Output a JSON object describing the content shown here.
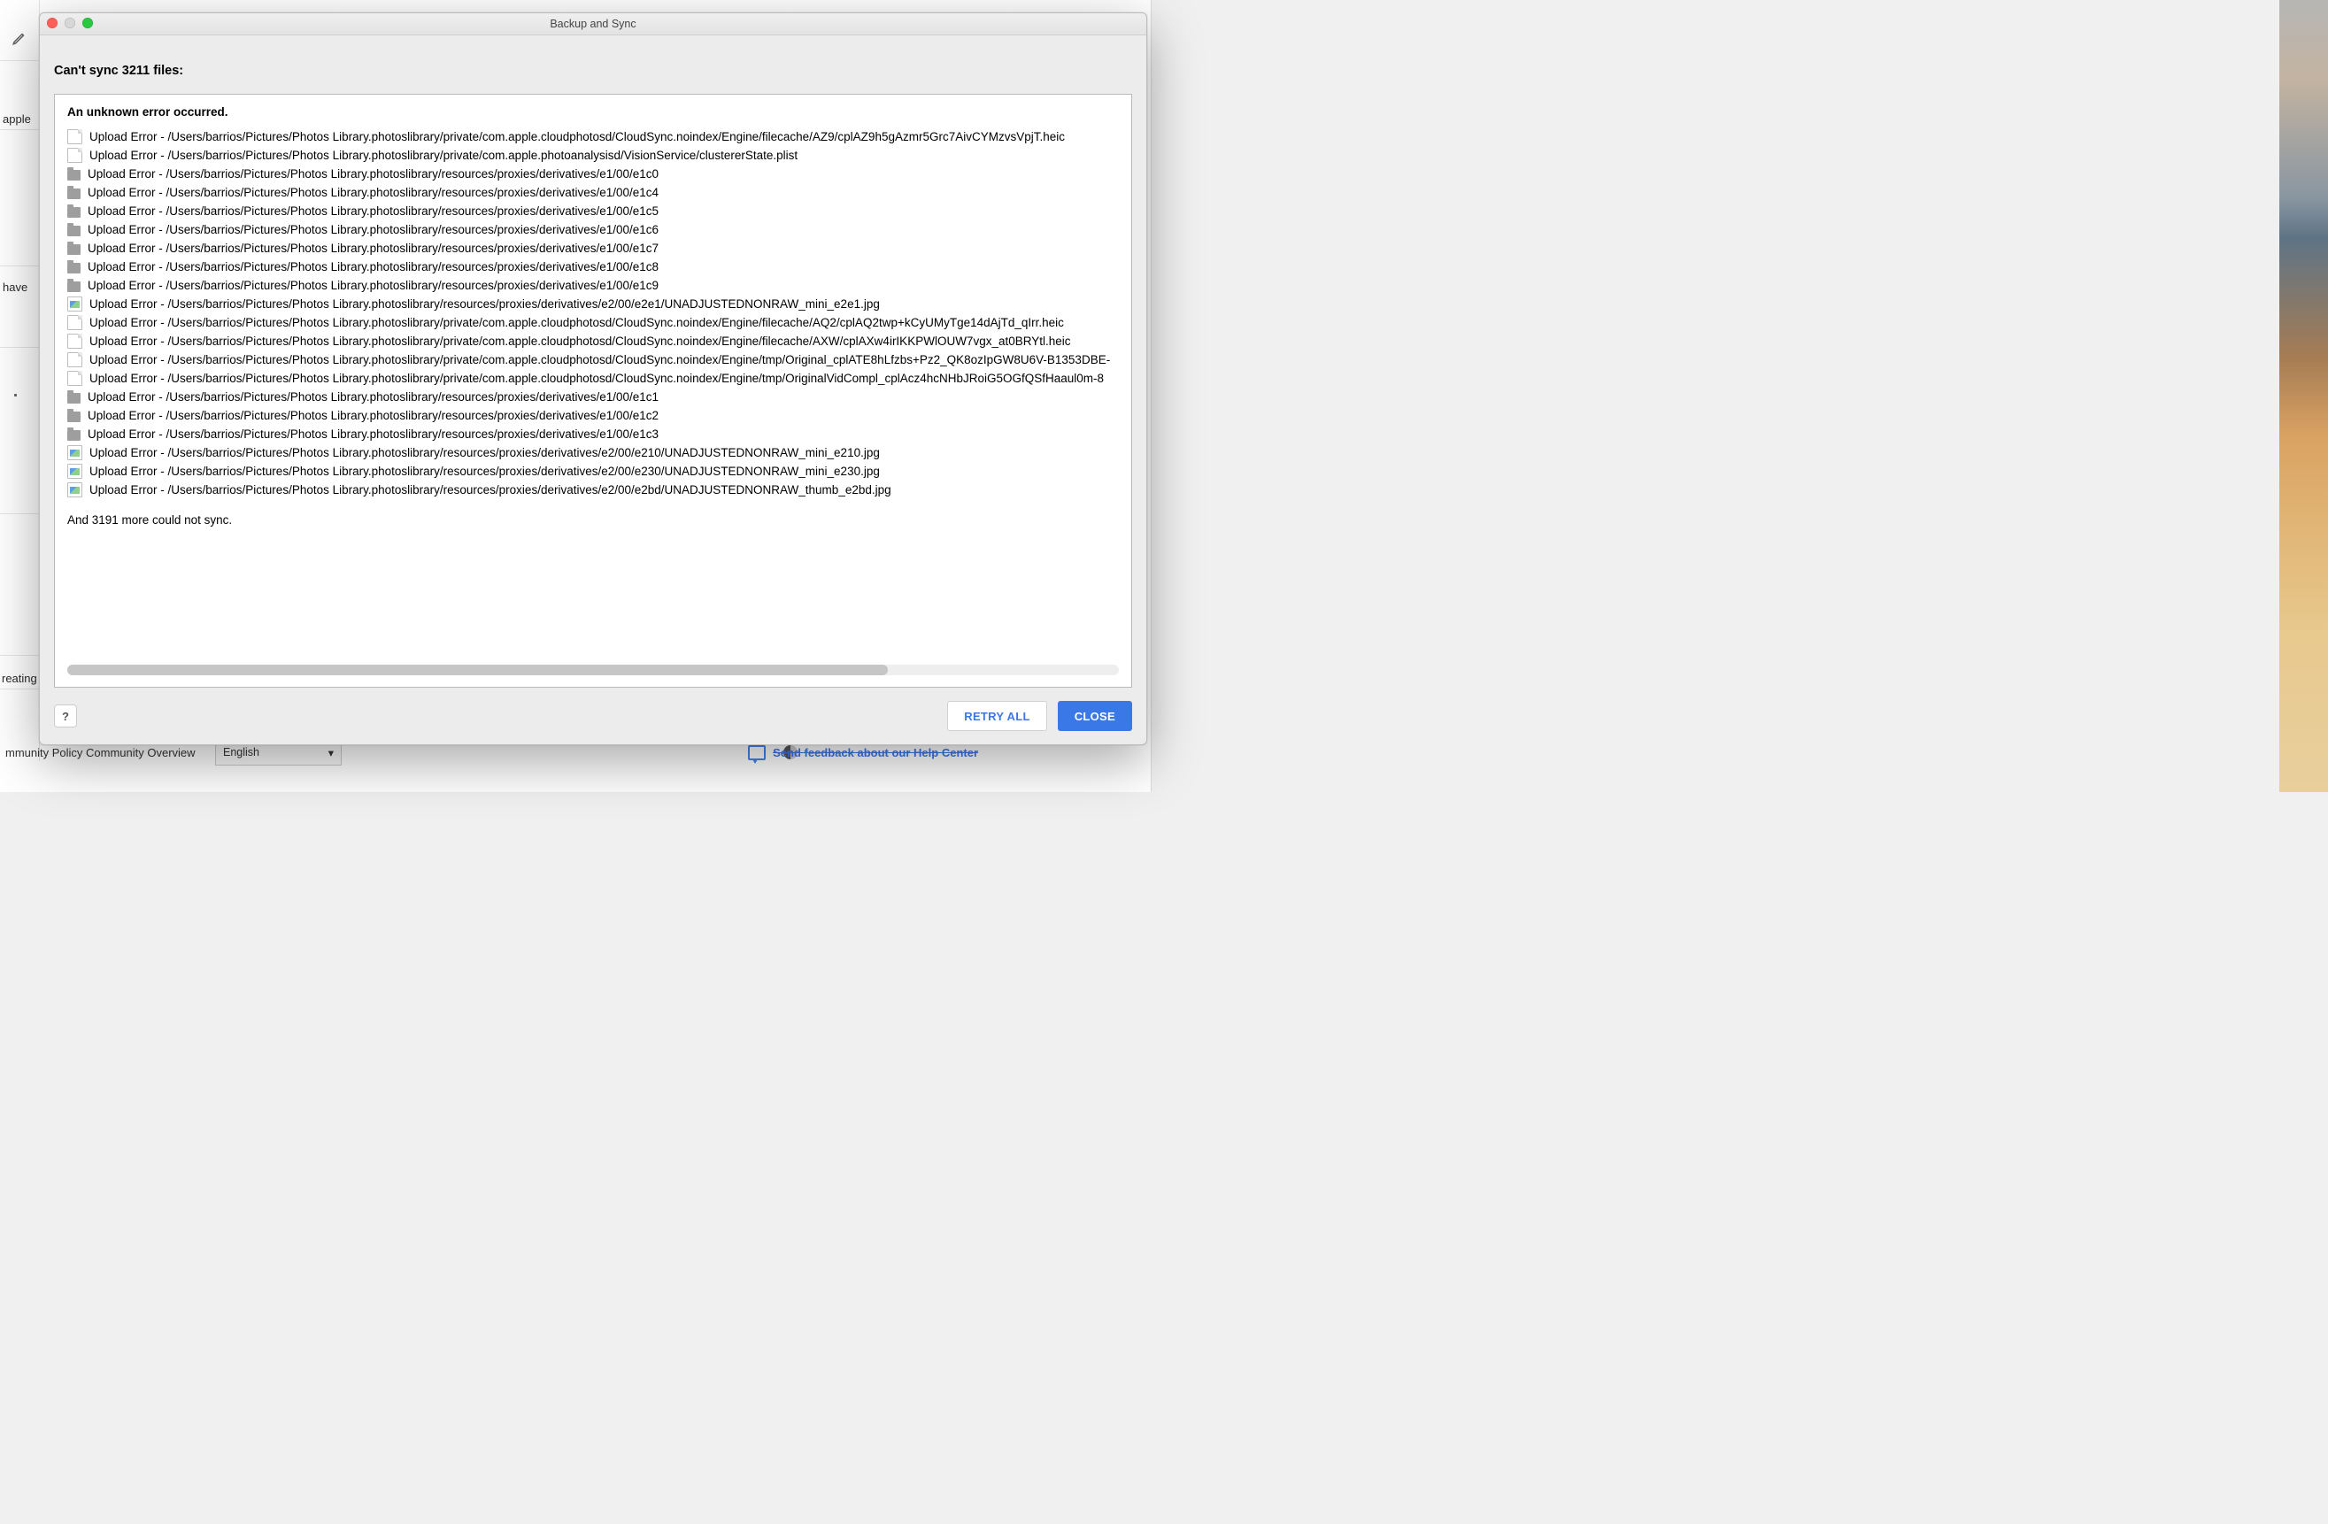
{
  "dialog": {
    "title": "Backup and Sync",
    "summary": "Can't sync 3211 files:",
    "error_heading": "An unknown error occurred.",
    "more_message": "And 3191 more could not sync.",
    "errors": [
      {
        "icon": "file",
        "text": "Upload Error - /Users/barrios/Pictures/Photos Library.photoslibrary/private/com.apple.cloudphotosd/CloudSync.noindex/Engine/filecache/AZ9/cplAZ9h5gAzmr5Grc7AivCYMzvsVpjT.heic"
      },
      {
        "icon": "file",
        "text": "Upload Error - /Users/barrios/Pictures/Photos Library.photoslibrary/private/com.apple.photoanalysisd/VisionService/clustererState.plist"
      },
      {
        "icon": "folder",
        "text": "Upload Error - /Users/barrios/Pictures/Photos Library.photoslibrary/resources/proxies/derivatives/e1/00/e1c0"
      },
      {
        "icon": "folder",
        "text": "Upload Error - /Users/barrios/Pictures/Photos Library.photoslibrary/resources/proxies/derivatives/e1/00/e1c4"
      },
      {
        "icon": "folder",
        "text": "Upload Error - /Users/barrios/Pictures/Photos Library.photoslibrary/resources/proxies/derivatives/e1/00/e1c5"
      },
      {
        "icon": "folder",
        "text": "Upload Error - /Users/barrios/Pictures/Photos Library.photoslibrary/resources/proxies/derivatives/e1/00/e1c6"
      },
      {
        "icon": "folder",
        "text": "Upload Error - /Users/barrios/Pictures/Photos Library.photoslibrary/resources/proxies/derivatives/e1/00/e1c7"
      },
      {
        "icon": "folder",
        "text": "Upload Error - /Users/barrios/Pictures/Photos Library.photoslibrary/resources/proxies/derivatives/e1/00/e1c8"
      },
      {
        "icon": "folder",
        "text": "Upload Error - /Users/barrios/Pictures/Photos Library.photoslibrary/resources/proxies/derivatives/e1/00/e1c9"
      },
      {
        "icon": "image",
        "text": "Upload Error - /Users/barrios/Pictures/Photos Library.photoslibrary/resources/proxies/derivatives/e2/00/e2e1/UNADJUSTEDNONRAW_mini_e2e1.jpg"
      },
      {
        "icon": "file",
        "text": "Upload Error - /Users/barrios/Pictures/Photos Library.photoslibrary/private/com.apple.cloudphotosd/CloudSync.noindex/Engine/filecache/AQ2/cplAQ2twp+kCyUMyTge14dAjTd_qIrr.heic"
      },
      {
        "icon": "file",
        "text": "Upload Error - /Users/barrios/Pictures/Photos Library.photoslibrary/private/com.apple.cloudphotosd/CloudSync.noindex/Engine/filecache/AXW/cplAXw4irIKKPWlOUW7vgx_at0BRYtl.heic"
      },
      {
        "icon": "file",
        "text": "Upload Error - /Users/barrios/Pictures/Photos Library.photoslibrary/private/com.apple.cloudphotosd/CloudSync.noindex/Engine/tmp/Original_cplATE8hLfzbs+Pz2_QK8ozIpGW8U6V-B1353DBE-"
      },
      {
        "icon": "file",
        "text": "Upload Error - /Users/barrios/Pictures/Photos Library.photoslibrary/private/com.apple.cloudphotosd/CloudSync.noindex/Engine/tmp/OriginalVidCompl_cplAcz4hcNHbJRoiG5OGfQSfHaaul0m-8"
      },
      {
        "icon": "folder",
        "text": "Upload Error - /Users/barrios/Pictures/Photos Library.photoslibrary/resources/proxies/derivatives/e1/00/e1c1"
      },
      {
        "icon": "folder",
        "text": "Upload Error - /Users/barrios/Pictures/Photos Library.photoslibrary/resources/proxies/derivatives/e1/00/e1c2"
      },
      {
        "icon": "folder",
        "text": "Upload Error - /Users/barrios/Pictures/Photos Library.photoslibrary/resources/proxies/derivatives/e1/00/e1c3"
      },
      {
        "icon": "image",
        "text": "Upload Error - /Users/barrios/Pictures/Photos Library.photoslibrary/resources/proxies/derivatives/e2/00/e210/UNADJUSTEDNONRAW_mini_e210.jpg"
      },
      {
        "icon": "image",
        "text": "Upload Error - /Users/barrios/Pictures/Photos Library.photoslibrary/resources/proxies/derivatives/e2/00/e230/UNADJUSTEDNONRAW_mini_e230.jpg"
      },
      {
        "icon": "image",
        "text": "Upload Error - /Users/barrios/Pictures/Photos Library.photoslibrary/resources/proxies/derivatives/e2/00/e2bd/UNADJUSTEDNONRAW_thumb_e2bd.jpg"
      }
    ],
    "scroll_thumb_pct": 78,
    "buttons": {
      "help": "?",
      "retry": "RETRY ALL",
      "close": "CLOSE"
    }
  },
  "background": {
    "frag_apple": "apple",
    "frag_have": "have",
    "frag_creating": "reating",
    "footer_frag": "mmunity Policy    Community Overview",
    "language": "English",
    "feedback_text": "Send feedback about our Help Center"
  }
}
